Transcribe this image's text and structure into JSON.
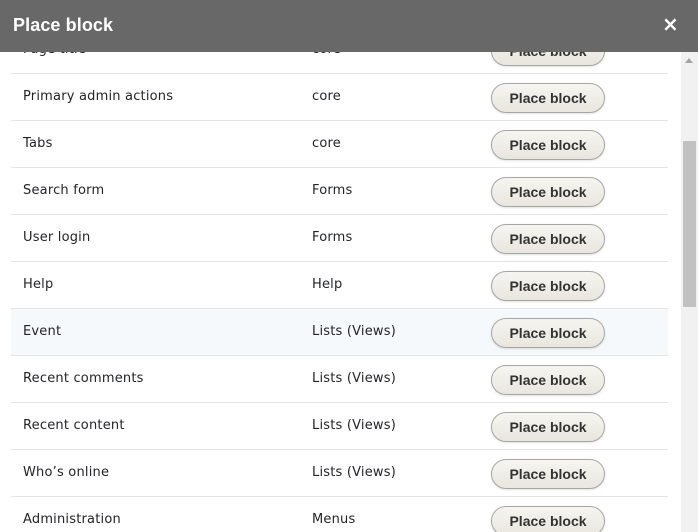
{
  "dialog": {
    "title": "Place block",
    "close_symbol": "×"
  },
  "blocks": [
    {
      "name": "Page title",
      "category": "core",
      "button": "Place block"
    },
    {
      "name": "Primary admin actions",
      "category": "core",
      "button": "Place block"
    },
    {
      "name": "Tabs",
      "category": "core",
      "button": "Place block"
    },
    {
      "name": "Search form",
      "category": "Forms",
      "button": "Place block"
    },
    {
      "name": "User login",
      "category": "Forms",
      "button": "Place block"
    },
    {
      "name": "Help",
      "category": "Help",
      "button": "Place block"
    },
    {
      "name": "Event",
      "category": "Lists (Views)",
      "button": "Place block"
    },
    {
      "name": "Recent comments",
      "category": "Lists (Views)",
      "button": "Place block"
    },
    {
      "name": "Recent content",
      "category": "Lists (Views)",
      "button": "Place block"
    },
    {
      "name": "Who’s online",
      "category": "Lists (Views)",
      "button": "Place block"
    },
    {
      "name": "Administration",
      "category": "Menus",
      "button": "Place block"
    }
  ],
  "icons": {
    "close": "close-icon",
    "scroll_up": "scroll-up-arrow-icon"
  },
  "colors": {
    "titlebar": "#686868",
    "row_highlight": "#f5f9fc",
    "button_bg": "#eeece6"
  }
}
